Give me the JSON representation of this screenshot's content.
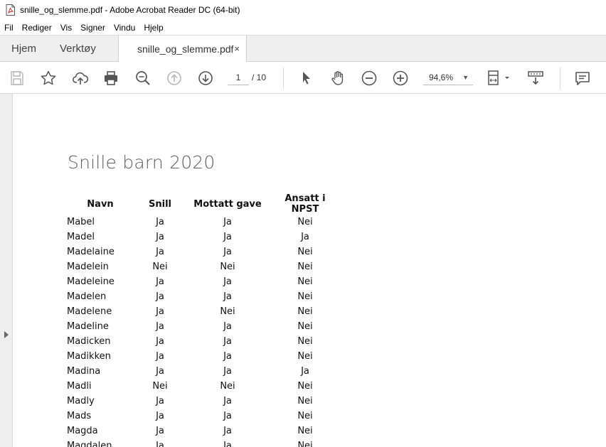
{
  "window": {
    "title": "snille_og_slemme.pdf - Adobe Acrobat Reader DC (64-bit)"
  },
  "menu": [
    "Fil",
    "Rediger",
    "Vis",
    "Signer",
    "Vindu",
    "Hjelp"
  ],
  "tabs": {
    "home": "Hjem",
    "tools": "Verktøy",
    "document": "snille_og_slemme.pdf",
    "close_symbol": "×"
  },
  "toolbar": {
    "current_page": "1",
    "total_pages": "/ 10",
    "zoom": "94,6%",
    "icons": [
      "save-icon",
      "bookmark-star-icon",
      "upload-icon",
      "print-icon",
      "zoom-search-icon",
      "page-up-icon",
      "page-down-icon",
      "select-pointer-icon",
      "hand-pan-icon",
      "zoom-out-icon",
      "zoom-in-icon",
      "page-fit-icon",
      "scroll-mode-icon",
      "comment-icon"
    ]
  },
  "document": {
    "title": "Snille barn 2020",
    "headers": [
      "Navn",
      "Snill",
      "Mottatt gave",
      "Ansatt i NPST"
    ],
    "rows": [
      [
        "Mabel",
        "Ja",
        "Ja",
        "Nei"
      ],
      [
        "Madel",
        "Ja",
        "Ja",
        "Ja"
      ],
      [
        "Madelaine",
        "Ja",
        "Ja",
        "Nei"
      ],
      [
        "Madelein",
        "Nei",
        "Nei",
        "Nei"
      ],
      [
        "Madeleine",
        "Ja",
        "Ja",
        "Nei"
      ],
      [
        "Madelen",
        "Ja",
        "Ja",
        "Nei"
      ],
      [
        "Madelene",
        "Ja",
        "Nei",
        "Nei"
      ],
      [
        "Madeline",
        "Ja",
        "Ja",
        "Nei"
      ],
      [
        "Madicken",
        "Ja",
        "Ja",
        "Nei"
      ],
      [
        "Madikken",
        "Ja",
        "Ja",
        "Nei"
      ],
      [
        "Madina",
        "Ja",
        "Ja",
        "Ja"
      ],
      [
        "Madli",
        "Nei",
        "Nei",
        "Nei"
      ],
      [
        "Madly",
        "Ja",
        "Ja",
        "Nei"
      ],
      [
        "Mads",
        "Ja",
        "Ja",
        "Nei"
      ],
      [
        "Magda",
        "Ja",
        "Ja",
        "Nei"
      ],
      [
        "Magdalen",
        "Ja",
        "Ja",
        "Nei"
      ]
    ]
  },
  "colors": {
    "toolbar_icon": "#5a5a5a",
    "disabled_icon": "#b8b8b8",
    "tab_bg": "#efefef"
  }
}
